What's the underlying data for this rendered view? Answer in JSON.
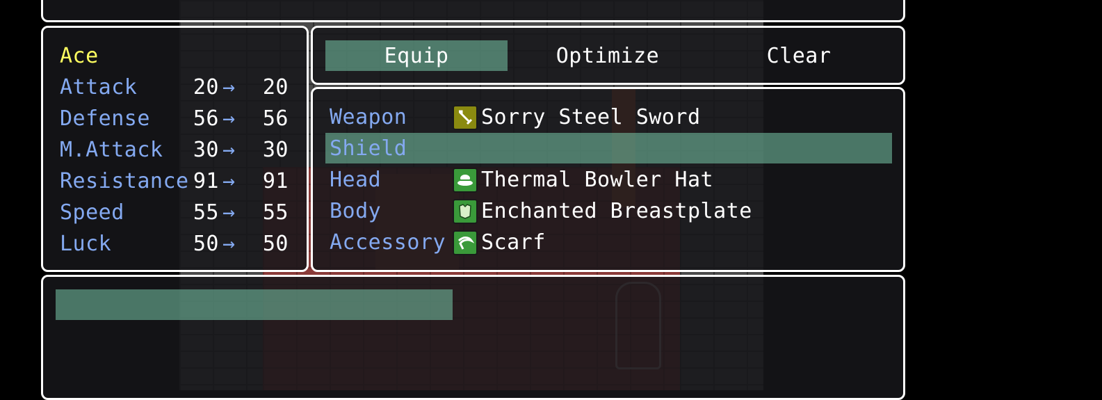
{
  "actor": {
    "name": "Ace"
  },
  "stats": [
    {
      "label": "Attack",
      "current": "20",
      "new": "20"
    },
    {
      "label": "Defense",
      "current": "56",
      "new": "56"
    },
    {
      "label": "M.Attack",
      "current": "30",
      "new": "30"
    },
    {
      "label": "Resistance",
      "current": "91",
      "new": "91"
    },
    {
      "label": "Speed",
      "current": "55",
      "new": "55"
    },
    {
      "label": "Luck",
      "current": "50",
      "new": "50"
    }
  ],
  "arrow_glyph": "→",
  "commands": {
    "equip": "Equip",
    "optimize": "Optimize",
    "clear": "Clear",
    "selected": "Equip"
  },
  "slots": [
    {
      "slot": "Weapon",
      "item": "Sorry Steel Sword",
      "icon": "sword-icon",
      "icon_color": "#8a8a10"
    },
    {
      "slot": "Shield",
      "item": "",
      "icon": "",
      "icon_color": ""
    },
    {
      "slot": "Head",
      "item": "Thermal Bowler Hat",
      "icon": "hat-icon",
      "icon_color": "#3a9a3a"
    },
    {
      "slot": "Body",
      "item": "Enchanted Breastplate",
      "icon": "armor-icon",
      "icon_color": "#3a9a3a"
    },
    {
      "slot": "Accessory",
      "item": "Scarf",
      "icon": "scarf-icon",
      "icon_color": "#3a9a3a"
    }
  ],
  "selected_slot": "Shield",
  "help": {
    "text": ""
  },
  "colors": {
    "system": "#84a9f0",
    "actor_name": "#ffff60",
    "highlight": "#78c8aa"
  }
}
